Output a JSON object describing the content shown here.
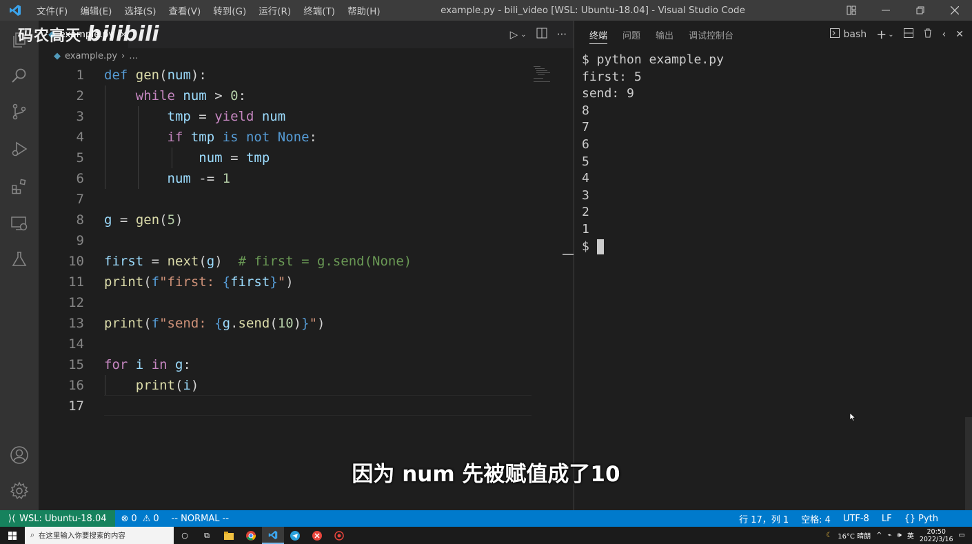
{
  "window": {
    "title": "example.py - bili_video [WSL: Ubuntu-18.04] - Visual Studio Code",
    "menu": [
      "文件(F)",
      "编辑(E)",
      "选择(S)",
      "查看(V)",
      "转到(G)",
      "运行(R)",
      "终端(T)",
      "帮助(H)"
    ]
  },
  "watermark": {
    "text_cn": "码农高天",
    "text_bili": "bilibili"
  },
  "editor": {
    "tab_label": "example.py",
    "breadcrumb_file": "example.py",
    "breadcrumb_rest": "…",
    "active_line": 17,
    "line_numbers": [
      "1",
      "2",
      "3",
      "4",
      "5",
      "6",
      "7",
      "8",
      "9",
      "10",
      "11",
      "12",
      "13",
      "14",
      "15",
      "16",
      "17"
    ],
    "tokens": {
      "def": "def",
      "gen": "gen",
      "num": "num",
      "while": "while",
      "gt0": ">",
      "zero": "0",
      "tmp": "tmp",
      "eq": "=",
      "yield": "yield",
      "if": "if",
      "is": "is",
      "not": "not",
      "None": "None",
      "minuseq": "-=",
      "one": "1",
      "g": "g",
      "five": "5",
      "first": "first",
      "next": "next",
      "comment": "# first = g.send(None)",
      "print": "print",
      "f": "f",
      "str_first": "\"first: ",
      "str_send": "\"send: ",
      "quote": "\"",
      "send": "send",
      "ten": "10",
      "for": "for",
      "i": "i",
      "in": "in",
      "colon": ":",
      "lparen": "(",
      "rparen": ")",
      "lbrace": "{",
      "rbrace": "}",
      "dot": ".",
      "defhead": "(num):",
      "paren_num": "(num):"
    }
  },
  "panel": {
    "tabs": [
      "终端",
      "问题",
      "输出",
      "调试控制台"
    ],
    "active_tab": "终端",
    "shell": "bash",
    "terminal_lines": [
      "$ python example.py",
      "first: 5",
      "send: 9",
      "8",
      "7",
      "6",
      "5",
      "4",
      "3",
      "2",
      "1"
    ],
    "prompt": "$ "
  },
  "subtitle": "因为 num 先被赋值成了10",
  "statusbar": {
    "remote": "WSL: Ubuntu-18.04",
    "errors": "0",
    "warnings": "0",
    "mode": "-- NORMAL --",
    "position": "行 17，列 1",
    "spaces": "空格: 4",
    "encoding": "UTF-8",
    "eol": "LF",
    "language": "Pyth"
  },
  "taskbar": {
    "search_placeholder": "在这里输入你要搜索的内容",
    "weather": "16°C 晴朗",
    "ime": "英",
    "time": "20:50",
    "date": "2022/3/16"
  },
  "colors": {
    "statusbar": "#007acc",
    "remote": "#16825d",
    "titlebar": "#3c3c3c",
    "activitybar": "#333333",
    "editor_bg": "#1e1e1e"
  }
}
